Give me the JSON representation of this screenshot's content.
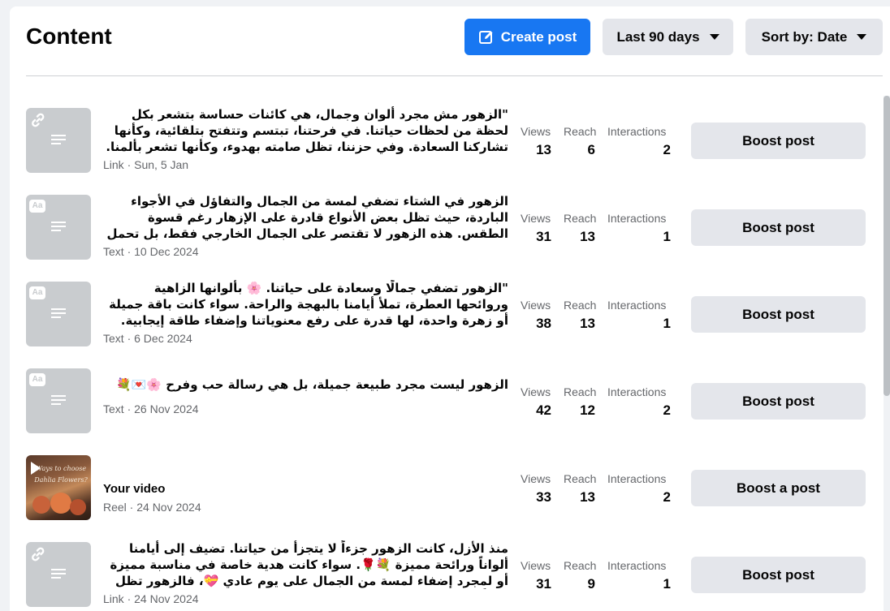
{
  "header": {
    "title": "Content",
    "create_label": "Create post",
    "date_range_label": "Last 90 days",
    "sort_label": "Sort by: Date"
  },
  "metric_labels": {
    "views": "Views",
    "reach": "Reach",
    "interactions": "Interactions"
  },
  "posts": [
    {
      "thumb_type": "link",
      "text": "\"الزهور مش مجرد ألوان وجمال، هي كائنات حساسة بتشعر بكل لحظة من لحظات حياتنا. في فرحتنا، تبتسم وتتفتح بتلقائية، وكأنها تشاركنا السعادة. وفي حزننا، تظل صامته بهدوء، وكأنها تشعر بألمنا. الزهور بتعكس ما في داخلنا....",
      "meta": "Link · Sun, 5 Jan",
      "views": "13",
      "reach": "6",
      "interactions": "2",
      "boost_label": "Boost post"
    },
    {
      "thumb_type": "text",
      "text": "الزهور في الشتاء تضفي لمسة من الجمال والتفاؤل في الأجواء الباردة، حيث تظل بعض الأنواع قادرة على الإزهار رغم قسوة الطقس. هذه الزهور لا تقتصر على الجمال الخارجي فقط، بل تحمل رسالة أمل وإصرار على الحياة رغم...",
      "meta": "Text · 10 Dec 2024",
      "views": "31",
      "reach": "13",
      "interactions": "1",
      "boost_label": "Boost post"
    },
    {
      "thumb_type": "text",
      "text": "\"الزهور تضفي جمالًا وسعادة على حياتنا. 🌸 بألوانها الزاهية وروائحها العطرة، تملأ أيامنا بالبهجة والراحة. سواء كانت باقة جميلة أو زهرة واحدة، لها قدرة على رفع معنوياتنا وإضفاء طاقة إيجابية. دعونا نقدر جمال الزهور...",
      "meta": "Text · 6 Dec 2024",
      "views": "38",
      "reach": "13",
      "interactions": "1",
      "boost_label": "Boost post"
    },
    {
      "thumb_type": "text",
      "text": "الزهور ليست مجرد طبيعة جميلة، بل هي رسالة حب وفرح 🌸💌💐",
      "meta": "Text · 26 Nov 2024",
      "views": "42",
      "reach": "12",
      "interactions": "2",
      "boost_label": "Boost post"
    },
    {
      "thumb_type": "video",
      "title": "Your video",
      "thumb_caption": "Ways to choose Dahlia Flowers?",
      "meta": "Reel · 24 Nov 2024",
      "views": "33",
      "reach": "13",
      "interactions": "2",
      "boost_label": "Boost a post"
    },
    {
      "thumb_type": "link",
      "text": "منذ الأزل، كانت الزهور جزءاً لا يتجزأ من حياتنا. تضيف إلى أيامنا ألواناً ورائحة مميزة 💐🌹. سواء كانت هدية خاصة في مناسبة مميزة أو لمجرد إضفاء لمسة من الجمال على يوم عادي 💝، فالزهور تظل رمزاً للحب والجمال....",
      "meta": "Link · 24 Nov 2024",
      "views": "31",
      "reach": "9",
      "interactions": "1",
      "boost_label": "Boost post"
    }
  ],
  "colors": {
    "primary": "#1877f2",
    "secondary_button": "#e4e6eb",
    "thumb_placeholder": "#c9cccf",
    "muted_text": "#65676b"
  }
}
